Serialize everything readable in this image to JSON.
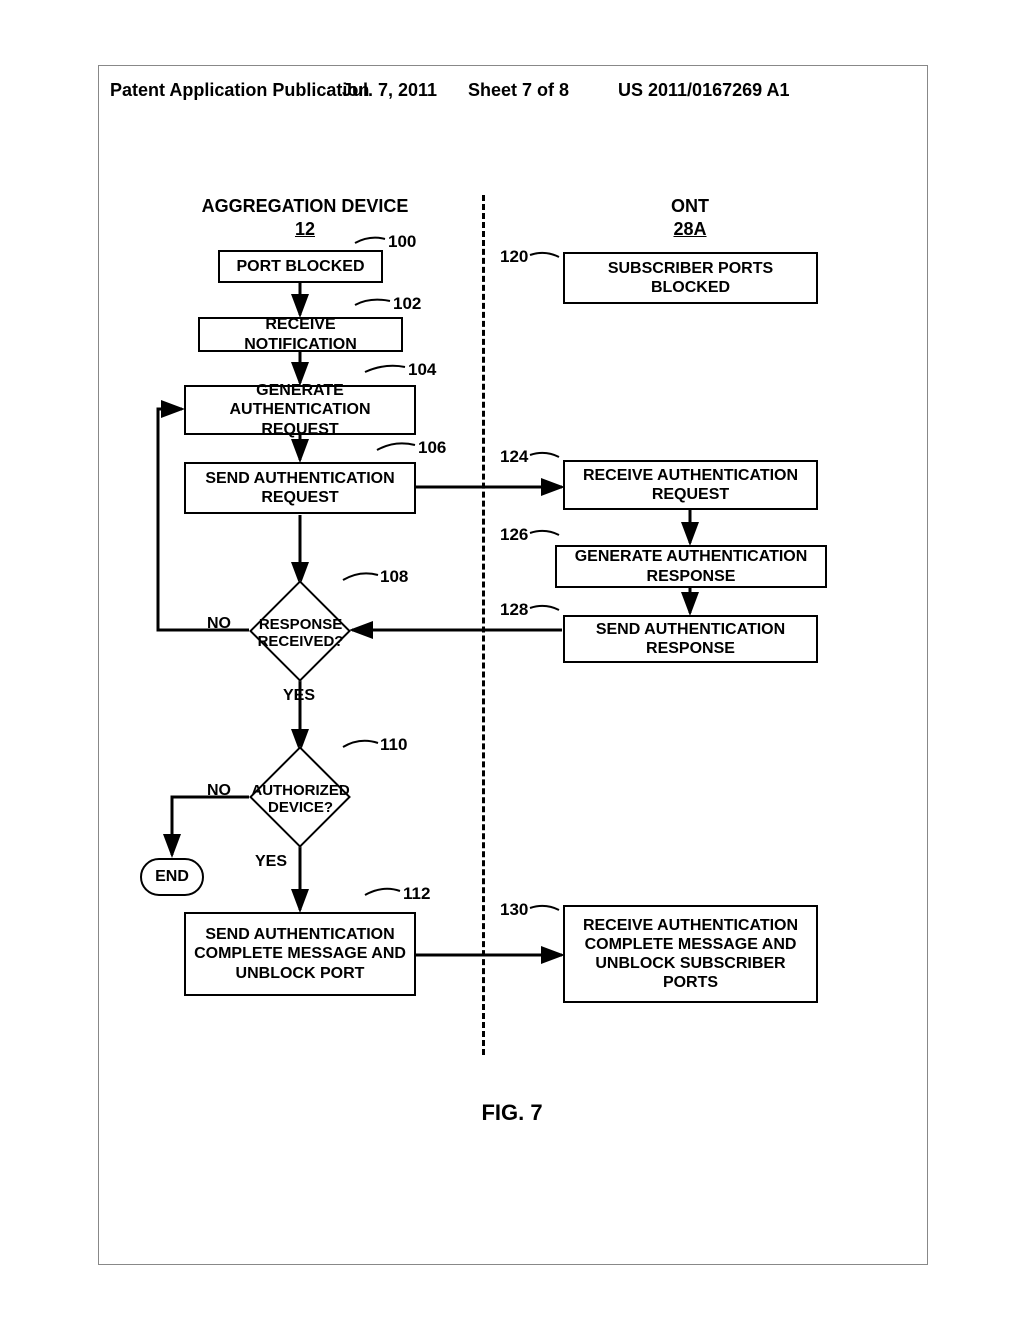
{
  "header": {
    "left": "Patent Application Publication",
    "date": "Jul. 7, 2011",
    "sheet": "Sheet 7 of 8",
    "pubno": "US 2011/0167269 A1"
  },
  "figure_caption": "FIG. 7",
  "columns": {
    "agg": {
      "title_line1": "AGGREGATION DEVICE",
      "title_line2": "12"
    },
    "ont": {
      "title_line1": "ONT",
      "title_line2": "28A"
    }
  },
  "agg_steps": {
    "s100": {
      "num": "100",
      "text": "PORT BLOCKED"
    },
    "s102": {
      "num": "102",
      "text": "RECEIVE NOTIFICATION"
    },
    "s104": {
      "num": "104",
      "text": "GENERATE AUTHENTICATION REQUEST"
    },
    "s106": {
      "num": "106",
      "text": "SEND AUTHENTICATION REQUEST"
    },
    "s108": {
      "num": "108",
      "text": "RESPONSE RECEIVED?"
    },
    "s110": {
      "num": "110",
      "text": "AUTHORIZED DEVICE?"
    },
    "s112": {
      "num": "112",
      "text": "SEND AUTHENTICATION COMPLETE MESSAGE AND UNBLOCK PORT"
    },
    "end": {
      "text": "END"
    }
  },
  "ont_steps": {
    "s120": {
      "num": "120",
      "text": "SUBSCRIBER PORTS BLOCKED"
    },
    "s124": {
      "num": "124",
      "text": "RECEIVE AUTHENTICATION REQUEST"
    },
    "s126": {
      "num": "126",
      "text": "GENERATE AUTHENTICATION RESPONSE"
    },
    "s128": {
      "num": "128",
      "text": "SEND AUTHENTICATION RESPONSE"
    },
    "s130": {
      "num": "130",
      "text": "RECEIVE AUTHENTICATION COMPLETE MESSAGE AND UNBLOCK SUBSCRIBER PORTS"
    }
  },
  "labels": {
    "yes": "YES",
    "no": "NO"
  }
}
